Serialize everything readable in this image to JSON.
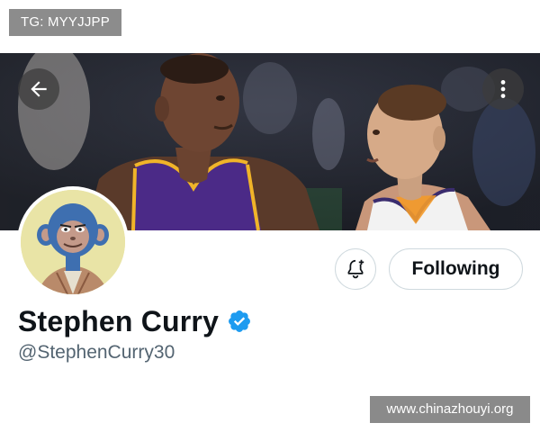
{
  "watermark_top": "TG: MYYJJPP",
  "watermark_bottom": "www.chinazhouyi.org",
  "header": {
    "back_icon": "arrow-left-icon",
    "more_icon": "more-vertical-icon"
  },
  "profile": {
    "display_name": "Stephen Curry",
    "handle": "@StephenCurry30",
    "verified": true,
    "verified_color": "#1d9bf0",
    "avatar_icon": "bored-ape-avatar"
  },
  "actions": {
    "notify_icon": "bell-plus-icon",
    "follow_label": "Following"
  },
  "colors": {
    "text_primary": "#0f1419",
    "text_secondary": "#536471",
    "border": "#cfd9de",
    "jersey_purple": "#4b2a87",
    "jersey_gold": "#f0b429"
  }
}
